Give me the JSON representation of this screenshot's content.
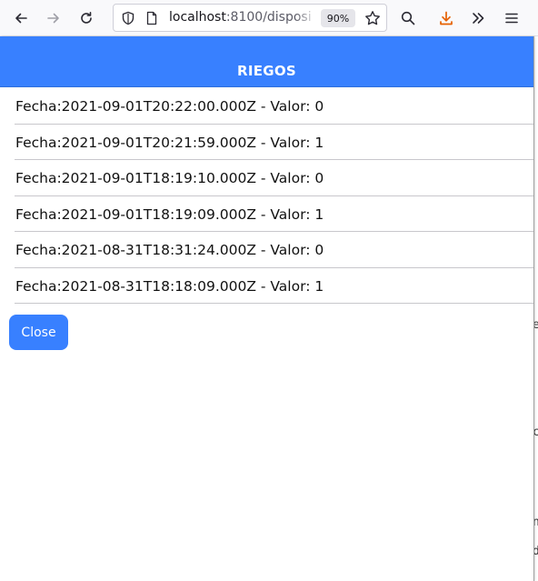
{
  "browser": {
    "url_host": "localhost",
    "url_rest": ":8100/disposi",
    "zoom": "90%"
  },
  "modal": {
    "title": "RIEGOS",
    "items": [
      {
        "text": "Fecha:2021-09-01T20:22:00.000Z - Valor: 0"
      },
      {
        "text": "Fecha:2021-09-01T20:21:59.000Z - Valor: 1"
      },
      {
        "text": "Fecha:2021-09-01T18:19:10.000Z - Valor: 0"
      },
      {
        "text": "Fecha:2021-09-01T18:19:09.000Z - Valor: 1"
      },
      {
        "text": "Fecha:2021-08-31T18:31:24.000Z - Valor: 0"
      },
      {
        "text": "Fecha:2021-08-31T18:18:09.000Z - Valor: 1"
      }
    ],
    "close_label": "Close"
  },
  "background_fragments": [
    "e",
    "c",
    "n",
    "d"
  ],
  "colors": {
    "accent": "#3880ff",
    "download": "#e66000"
  }
}
